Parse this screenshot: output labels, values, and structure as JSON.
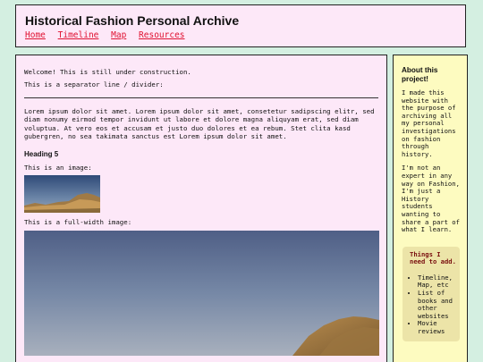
{
  "header": {
    "title": "Historical Fashion Personal Archive",
    "nav": [
      "Home",
      "Timeline",
      "Map",
      "Resources"
    ]
  },
  "main": {
    "welcome": "Welcome! This is still under construction.",
    "separator_label": "This is a separator line / divider:",
    "lorem": "Lorem ipsum dolor sit amet. Lorem ipsum dolor sit amet, consetetur sadipscing elitr, sed diam nonumy eirmod tempor invidunt ut labore et dolore magna aliquyam erat, sed diam voluptua. At vero eos et accusam et justo duo dolores et ea rebum. Stet clita kasd gubergren, no sea takimata sanctus est Lorem ipsum dolor sit amet.",
    "heading5": "Heading 5",
    "image_label": "This is an image:",
    "full_image_label": "This is a full-width image:"
  },
  "aside": {
    "title": "About this project!",
    "para1": "I made this website with the purpose of archiving all my personal investigations on fashion through history.",
    "para2": "I'm not an expert in any way on Fashion, I'm just a History students wanting to share a part of what I learn.",
    "todo_title": "Things I need to add.",
    "todo_items": [
      "Timeline, Map, etc",
      "List of books and other websites",
      "Movie reviews"
    ]
  },
  "colors": {
    "page_bg": "#d4efe1",
    "panel_pink": "#fde8f8",
    "panel_yellow": "#fdfbc0",
    "link_red": "#e01030",
    "todo_bg": "#ece4a8"
  }
}
